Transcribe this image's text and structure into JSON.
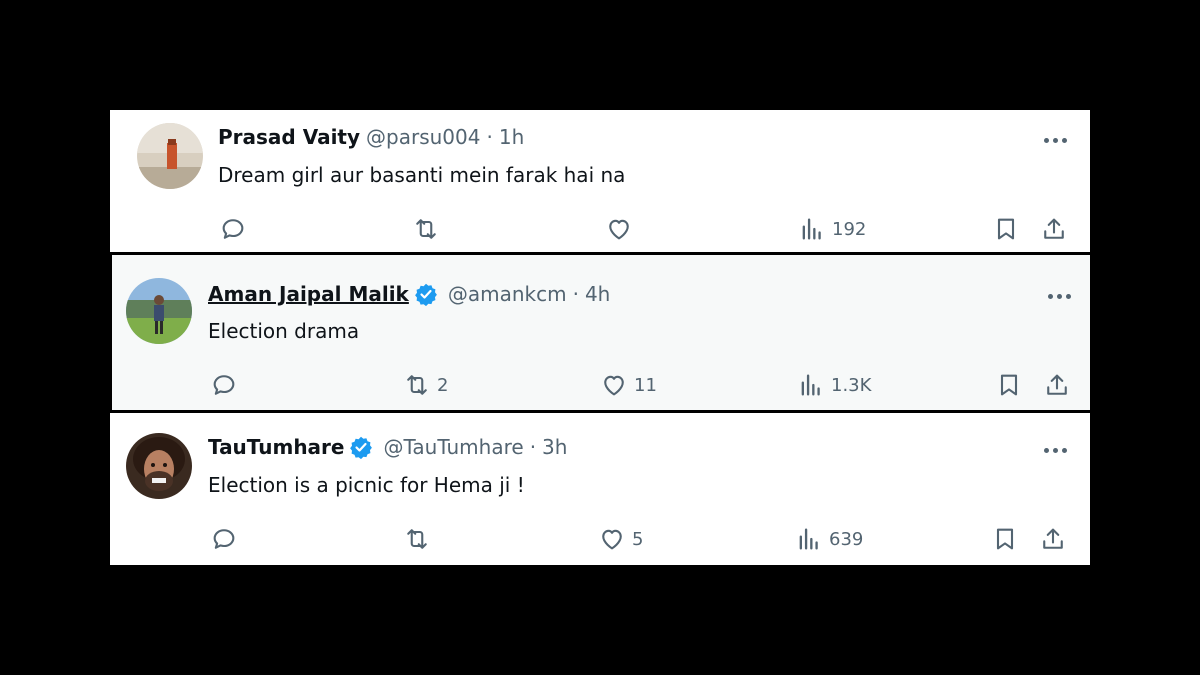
{
  "colors": {
    "background": "#000000",
    "panel": "#ffffff",
    "panel_hover": "#f7f9f9",
    "text_primary": "#0f1419",
    "text_secondary": "#536471",
    "verified_blue": "#1d9bf0"
  },
  "tweets": [
    {
      "name": "Prasad Vaity",
      "handle": "@parsu004",
      "separator": "·",
      "time": "1h",
      "text": "Dream girl aur basanti mein farak hai na",
      "verified": false,
      "reply_count": "",
      "retweet_count": "",
      "like_count": "",
      "views": "192",
      "icons": [
        "reply-icon",
        "retweet-icon",
        "like-icon",
        "views-icon",
        "bookmark-icon",
        "share-icon",
        "more-icon"
      ]
    },
    {
      "name": "Aman Jaipal Malik",
      "handle": "@amankcm",
      "separator": "·",
      "time": "4h",
      "text": "Election drama",
      "verified": true,
      "reply_count": "",
      "retweet_count": "2",
      "like_count": "11",
      "views": "1.3K",
      "icons": [
        "reply-icon",
        "retweet-icon",
        "like-icon",
        "views-icon",
        "bookmark-icon",
        "share-icon",
        "more-icon"
      ]
    },
    {
      "name": "TauTumhare",
      "handle": "@TauTumhare",
      "separator": "·",
      "time": "3h",
      "text": "Election is a picnic for Hema ji !",
      "verified": true,
      "reply_count": "",
      "retweet_count": "",
      "like_count": "5",
      "views": "639",
      "icons": [
        "reply-icon",
        "retweet-icon",
        "like-icon",
        "views-icon",
        "bookmark-icon",
        "share-icon",
        "more-icon"
      ]
    }
  ]
}
